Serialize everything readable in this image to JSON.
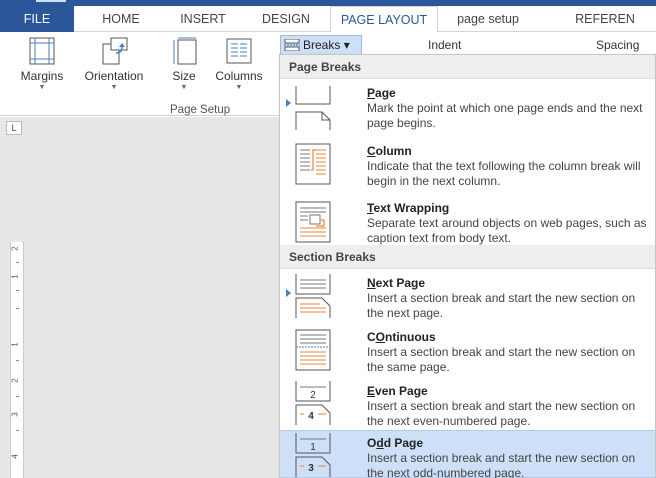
{
  "tabs": [
    {
      "label": "FILE"
    },
    {
      "label": "HOME"
    },
    {
      "label": "INSERT"
    },
    {
      "label": "DESIGN"
    },
    {
      "label": "PAGE LAYOUT"
    },
    {
      "label": "page setup"
    },
    {
      "label": "REFEREN"
    }
  ],
  "ribbon": {
    "buttons": [
      {
        "label": "Margins"
      },
      {
        "label": "Orientation"
      },
      {
        "label": "Size"
      },
      {
        "label": "Columns"
      }
    ],
    "group_label": "Page Setup",
    "breaks_label": "Breaks",
    "breaks_arrow": "▾",
    "indent_label": "Indent",
    "spacing_label": "Spacing"
  },
  "ruler": {
    "corner": "L",
    "numbers": [
      "2",
      "1",
      "1",
      "2",
      "3",
      "4"
    ]
  },
  "menu": {
    "page_breaks_header": "Page Breaks",
    "section_breaks_header": "Section Breaks",
    "page_items": [
      {
        "key": "P",
        "rest": "age",
        "desc": "Mark the point at which one page ends and the next page begins."
      },
      {
        "key": "C",
        "rest": "olumn",
        "desc": "Indicate that the text following the column break will begin in the next column."
      },
      {
        "key": "T",
        "rest": "ext Wrapping",
        "desc": "Separate text around objects on web pages, such as caption text from body text."
      }
    ],
    "section_items": [
      {
        "key": "N",
        "rest": "ext Page",
        "desc": "Insert a section break and start the new section on the next page."
      },
      {
        "key": "O",
        "rest": "ntinuous",
        "prefix": "C",
        "desc": "Insert a section break and start the new section on the same page."
      },
      {
        "key": "E",
        "rest": "ven Page",
        "desc": "Insert a section break and start the new section on the next even-numbered page."
      },
      {
        "key": "d",
        "rest": "d Page",
        "prefix": "O",
        "desc": "Insert a section break and start the new section on the next odd-numbered page."
      }
    ],
    "thumb_labels": {
      "even": "2",
      "even_next": "4",
      "odd": "1",
      "odd_next": "3"
    }
  },
  "colors": {
    "accent": "#2b579a",
    "hover": "#cde0f7",
    "orange": "#e8873a"
  }
}
